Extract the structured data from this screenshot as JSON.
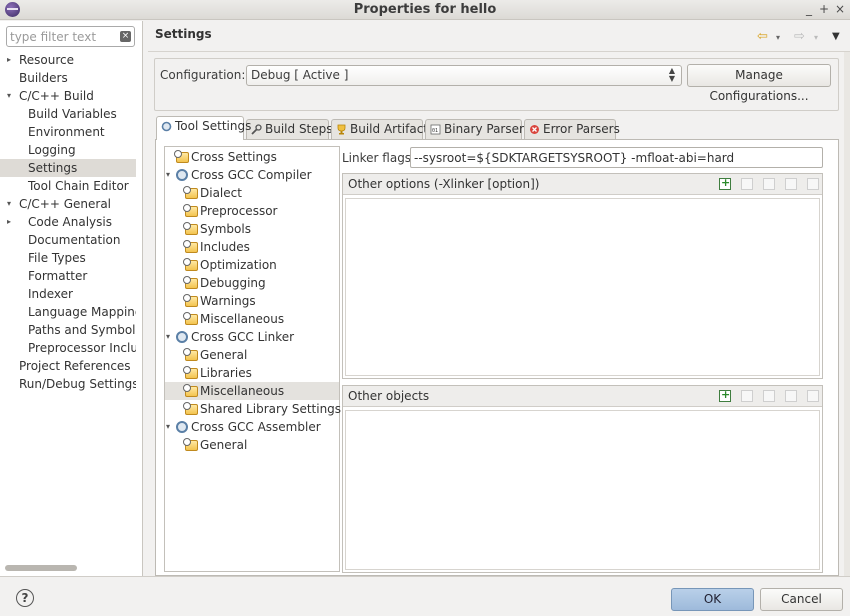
{
  "window": {
    "title": "Properties for hello",
    "controls": [
      "_",
      "+",
      "×"
    ]
  },
  "filter": {
    "placeholder": "type filter text",
    "value": ""
  },
  "left_tree": [
    {
      "label": "Resource",
      "arrow": "▸"
    },
    {
      "label": "Builders",
      "arrow": ""
    },
    {
      "label": "C/C++ Build",
      "arrow": "▾"
    },
    {
      "label": "Build Variables",
      "arrow": ""
    },
    {
      "label": "Environment",
      "arrow": ""
    },
    {
      "label": "Logging",
      "arrow": ""
    },
    {
      "label": "Settings",
      "arrow": ""
    },
    {
      "label": "Tool Chain Editor",
      "arrow": ""
    },
    {
      "label": "C/C++ General",
      "arrow": "▾"
    },
    {
      "label": "Code Analysis",
      "arrow": "▸"
    },
    {
      "label": "Documentation",
      "arrow": ""
    },
    {
      "label": "File Types",
      "arrow": ""
    },
    {
      "label": "Formatter",
      "arrow": ""
    },
    {
      "label": "Indexer",
      "arrow": ""
    },
    {
      "label": "Language Mappings",
      "arrow": ""
    },
    {
      "label": "Paths and Symbols",
      "arrow": ""
    },
    {
      "label": "Preprocessor Include",
      "arrow": ""
    },
    {
      "label": "Project References",
      "arrow": ""
    },
    {
      "label": "Run/Debug Settings",
      "arrow": ""
    }
  ],
  "page": {
    "title": "Settings"
  },
  "configuration": {
    "label": "Configuration:",
    "value": "Debug  [ Active ]",
    "manage_label": "Manage Configurations..."
  },
  "tabs": [
    {
      "label": "Tool Settings"
    },
    {
      "label": "Build Steps"
    },
    {
      "label": "Build Artifact"
    },
    {
      "label": "Binary Parsers"
    },
    {
      "label": "Error Parsers"
    }
  ],
  "tool_tree": [
    {
      "label": "Cross Settings",
      "arrow": ""
    },
    {
      "label": "Cross GCC Compiler",
      "arrow": "▾"
    },
    {
      "label": "Dialect",
      "arrow": ""
    },
    {
      "label": "Preprocessor",
      "arrow": ""
    },
    {
      "label": "Symbols",
      "arrow": ""
    },
    {
      "label": "Includes",
      "arrow": ""
    },
    {
      "label": "Optimization",
      "arrow": ""
    },
    {
      "label": "Debugging",
      "arrow": ""
    },
    {
      "label": "Warnings",
      "arrow": ""
    },
    {
      "label": "Miscellaneous",
      "arrow": ""
    },
    {
      "label": "Cross GCC Linker",
      "arrow": "▾"
    },
    {
      "label": "General",
      "arrow": ""
    },
    {
      "label": "Libraries",
      "arrow": ""
    },
    {
      "label": "Miscellaneous",
      "arrow": ""
    },
    {
      "label": "Shared Library Settings",
      "arrow": ""
    },
    {
      "label": "Cross GCC Assembler",
      "arrow": "▾"
    },
    {
      "label": "General",
      "arrow": ""
    }
  ],
  "linker": {
    "flags_label": "Linker flags",
    "flags_value": "--sysroot=${SDKTARGETSYSROOT} -mfloat-abi=hard",
    "other_options_label": "Other options (-Xlinker [option])",
    "other_objects_label": "Other objects"
  },
  "footer": {
    "help": "?",
    "ok_label": "OK",
    "cancel_label": "Cancel"
  }
}
